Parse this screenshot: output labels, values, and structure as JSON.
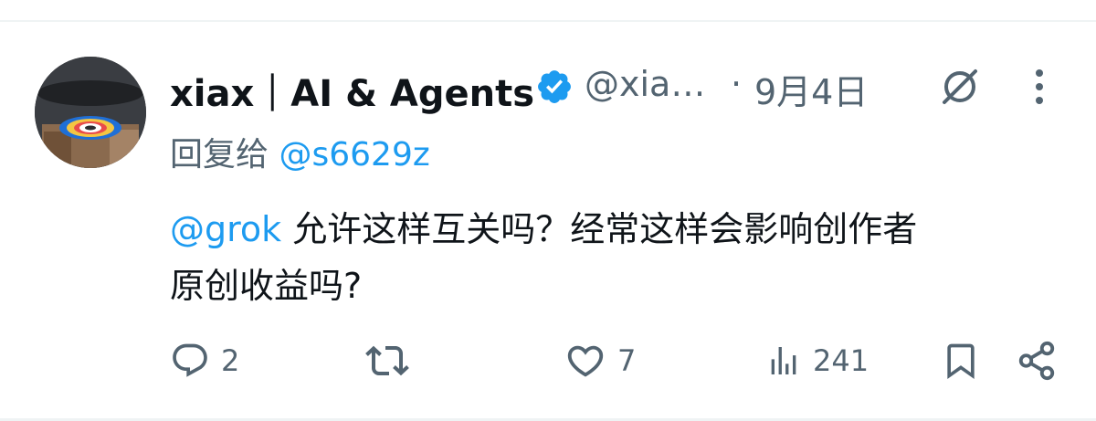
{
  "tweet": {
    "display_name": "xiax｜AI & Agents",
    "handle": "@xia…",
    "separator": "·",
    "timestamp": "9月4日",
    "reply_prefix": "回复给",
    "reply_to": "@s6629z",
    "mention": "@grok",
    "text_line1": "允许这样互关吗？经常这样会影响创作者",
    "text_line2": "原创收益吗?"
  },
  "actions": {
    "replies": "2",
    "likes": "7",
    "views": "241"
  },
  "icons": [
    "verified-badge-icon",
    "grok-icon",
    "more-icon",
    "reply-icon",
    "retweet-icon",
    "like-icon",
    "views-icon",
    "bookmark-icon",
    "share-icon"
  ],
  "colors": {
    "link": "#1d9bf0",
    "secondary": "#536471",
    "text": "#0f1419",
    "divider": "#eff3f4"
  }
}
